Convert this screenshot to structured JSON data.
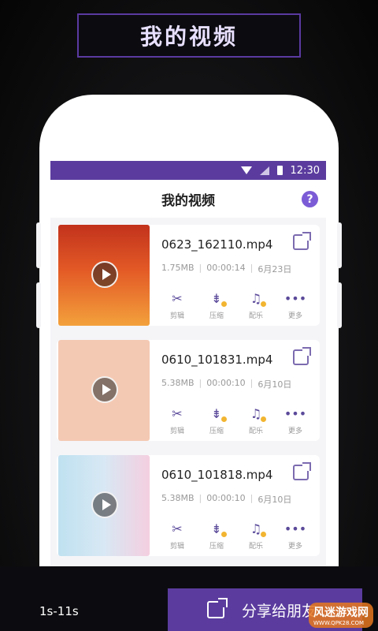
{
  "banner": {
    "title": "我的视频"
  },
  "status": {
    "time": "12:30"
  },
  "app": {
    "title": "我的视频",
    "help_icon": "?"
  },
  "videos": [
    {
      "filename": "0623_162110.mp4",
      "size": "1.75MB",
      "duration": "00:00:14",
      "date": "6月23日"
    },
    {
      "filename": "0610_101831.mp4",
      "size": "5.38MB",
      "duration": "00:00:10",
      "date": "6月10日"
    },
    {
      "filename": "0610_101818.mp4",
      "size": "5.38MB",
      "duration": "00:00:10",
      "date": "6月10日"
    }
  ],
  "actions": {
    "cut": "剪辑",
    "compress": "压缩",
    "music": "配乐",
    "more": "更多"
  },
  "bottom": {
    "duration_range": "1s-11s",
    "share_label": "分享给朋友"
  },
  "watermark": {
    "main": "风迷游戏网",
    "sub": "WWW.QPK28.COM"
  },
  "colors": {
    "accent": "#5b3c9e",
    "icon": "#5b4a9a",
    "vip_badge": "#f2b531"
  }
}
